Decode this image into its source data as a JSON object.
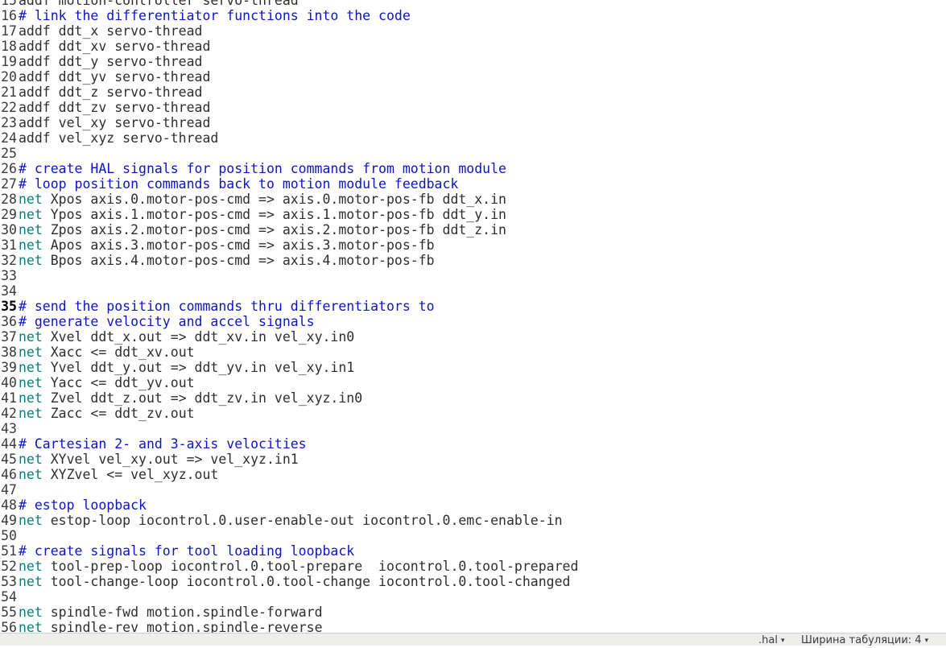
{
  "editor": {
    "current_line": "35",
    "lines": [
      {
        "n": "15",
        "parts": [
          {
            "t": "addf motion-controller servo-thread",
            "c": "txt"
          }
        ]
      },
      {
        "n": "16",
        "parts": [
          {
            "t": "# link the differentiator functions into the code",
            "c": "comment"
          }
        ]
      },
      {
        "n": "17",
        "parts": [
          {
            "t": "addf ddt_x servo-thread",
            "c": "txt"
          }
        ]
      },
      {
        "n": "18",
        "parts": [
          {
            "t": "addf ddt_xv servo-thread",
            "c": "txt"
          }
        ]
      },
      {
        "n": "19",
        "parts": [
          {
            "t": "addf ddt_y servo-thread",
            "c": "txt"
          }
        ]
      },
      {
        "n": "20",
        "parts": [
          {
            "t": "addf ddt_yv servo-thread",
            "c": "txt"
          }
        ]
      },
      {
        "n": "21",
        "parts": [
          {
            "t": "addf ddt_z servo-thread",
            "c": "txt"
          }
        ]
      },
      {
        "n": "22",
        "parts": [
          {
            "t": "addf ddt_zv servo-thread",
            "c": "txt"
          }
        ]
      },
      {
        "n": "23",
        "parts": [
          {
            "t": "addf vel_xy servo-thread",
            "c": "txt"
          }
        ]
      },
      {
        "n": "24",
        "parts": [
          {
            "t": "addf vel_xyz servo-thread",
            "c": "txt"
          }
        ]
      },
      {
        "n": "25",
        "parts": []
      },
      {
        "n": "26",
        "parts": [
          {
            "t": "# create HAL signals for position commands from motion module",
            "c": "comment"
          }
        ]
      },
      {
        "n": "27",
        "parts": [
          {
            "t": "# loop position commands back to motion module feedback",
            "c": "comment"
          }
        ]
      },
      {
        "n": "28",
        "parts": [
          {
            "t": "net",
            "c": "kw"
          },
          {
            "t": " Xpos axis.0.motor-pos-cmd => axis.0.motor-pos-fb ddt_x.in",
            "c": "txt"
          }
        ]
      },
      {
        "n": "29",
        "parts": [
          {
            "t": "net",
            "c": "kw"
          },
          {
            "t": " Ypos axis.1.motor-pos-cmd => axis.1.motor-pos-fb ddt_y.in",
            "c": "txt"
          }
        ]
      },
      {
        "n": "30",
        "parts": [
          {
            "t": "net",
            "c": "kw"
          },
          {
            "t": " Zpos axis.2.motor-pos-cmd => axis.2.motor-pos-fb ddt_z.in",
            "c": "txt"
          }
        ]
      },
      {
        "n": "31",
        "parts": [
          {
            "t": "net",
            "c": "kw"
          },
          {
            "t": " Apos axis.3.motor-pos-cmd => axis.3.motor-pos-fb",
            "c": "txt"
          }
        ]
      },
      {
        "n": "32",
        "parts": [
          {
            "t": "net",
            "c": "kw"
          },
          {
            "t": " Bpos axis.4.motor-pos-cmd => axis.4.motor-pos-fb",
            "c": "txt"
          }
        ]
      },
      {
        "n": "33",
        "parts": []
      },
      {
        "n": "34",
        "parts": []
      },
      {
        "n": "35",
        "parts": [
          {
            "t": "# send the position commands thru differentiators to",
            "c": "comment"
          }
        ]
      },
      {
        "n": "36",
        "parts": [
          {
            "t": "# generate velocity and accel signals",
            "c": "comment"
          }
        ]
      },
      {
        "n": "37",
        "parts": [
          {
            "t": "net",
            "c": "kw"
          },
          {
            "t": " Xvel ddt_x.out => ddt_xv.in vel_xy.in0",
            "c": "txt"
          }
        ]
      },
      {
        "n": "38",
        "parts": [
          {
            "t": "net",
            "c": "kw"
          },
          {
            "t": " Xacc <= ddt_xv.out",
            "c": "txt"
          }
        ]
      },
      {
        "n": "39",
        "parts": [
          {
            "t": "net",
            "c": "kw"
          },
          {
            "t": " Yvel ddt_y.out => ddt_yv.in vel_xy.in1",
            "c": "txt"
          }
        ]
      },
      {
        "n": "40",
        "parts": [
          {
            "t": "net",
            "c": "kw"
          },
          {
            "t": " Yacc <= ddt_yv.out",
            "c": "txt"
          }
        ]
      },
      {
        "n": "41",
        "parts": [
          {
            "t": "net",
            "c": "kw"
          },
          {
            "t": " Zvel ddt_z.out => ddt_zv.in vel_xyz.in0",
            "c": "txt"
          }
        ]
      },
      {
        "n": "42",
        "parts": [
          {
            "t": "net",
            "c": "kw"
          },
          {
            "t": " Zacc <= ddt_zv.out",
            "c": "txt"
          }
        ]
      },
      {
        "n": "43",
        "parts": []
      },
      {
        "n": "44",
        "parts": [
          {
            "t": "# Cartesian 2- and 3-axis velocities",
            "c": "comment"
          }
        ]
      },
      {
        "n": "45",
        "parts": [
          {
            "t": "net",
            "c": "kw"
          },
          {
            "t": " XYvel vel_xy.out => vel_xyz.in1",
            "c": "txt"
          }
        ]
      },
      {
        "n": "46",
        "parts": [
          {
            "t": "net",
            "c": "kw"
          },
          {
            "t": " XYZvel <= vel_xyz.out",
            "c": "txt"
          }
        ]
      },
      {
        "n": "47",
        "parts": []
      },
      {
        "n": "48",
        "parts": [
          {
            "t": "# estop loopback",
            "c": "comment"
          }
        ]
      },
      {
        "n": "49",
        "parts": [
          {
            "t": "net",
            "c": "kw"
          },
          {
            "t": " estop-loop iocontrol.0.user-enable-out iocontrol.0.emc-enable-in",
            "c": "txt"
          }
        ]
      },
      {
        "n": "50",
        "parts": []
      },
      {
        "n": "51",
        "parts": [
          {
            "t": "# create signals for tool loading loopback",
            "c": "comment"
          }
        ]
      },
      {
        "n": "52",
        "parts": [
          {
            "t": "net",
            "c": "kw"
          },
          {
            "t": " tool-prep-loop iocontrol.0.tool-prepare  iocontrol.0.tool-prepared",
            "c": "txt"
          }
        ]
      },
      {
        "n": "53",
        "parts": [
          {
            "t": "net",
            "c": "kw"
          },
          {
            "t": " tool-change-loop iocontrol.0.tool-change iocontrol.0.tool-changed",
            "c": "txt"
          }
        ]
      },
      {
        "n": "54",
        "parts": []
      },
      {
        "n": "55",
        "parts": [
          {
            "t": "net",
            "c": "kw"
          },
          {
            "t": " spindle-fwd motion.spindle-forward",
            "c": "txt"
          }
        ]
      },
      {
        "n": "56",
        "parts": [
          {
            "t": "net",
            "c": "kw"
          },
          {
            "t": " spindle-rev motion.spindle-reverse",
            "c": "txt"
          }
        ]
      }
    ]
  },
  "statusbar": {
    "language": ".hal",
    "tab_width_label": "Ширина табуляции: 4",
    "dropdown_glyph": "▾"
  },
  "colors": {
    "comment": "#0d14c8",
    "keyword": "#05807a",
    "text": "#2e2e2e"
  }
}
